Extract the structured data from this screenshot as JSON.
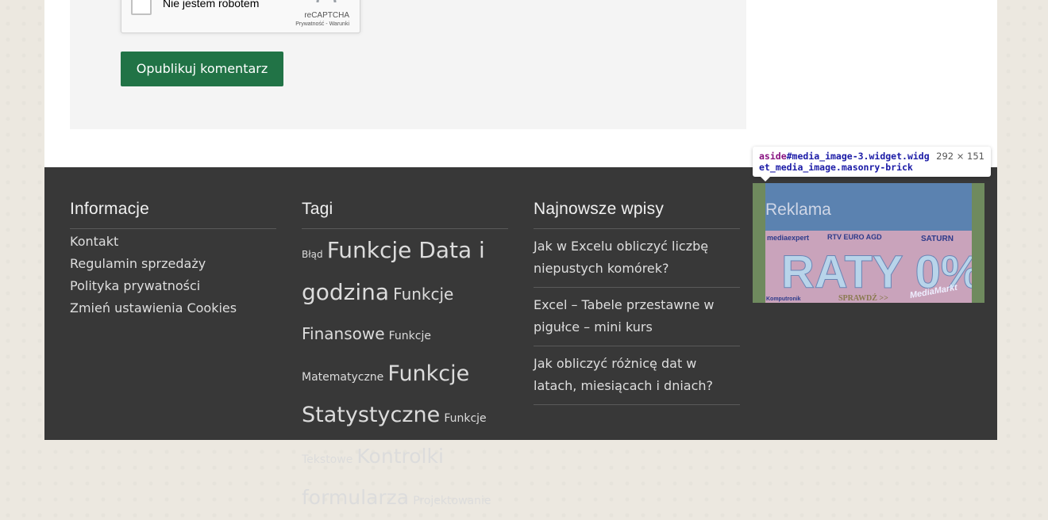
{
  "comment_form": {
    "recaptcha_label": "Nie jestem robotem",
    "recaptcha_brand": "reCAPTCHA",
    "recaptcha_terms": "Prywatność - Warunki",
    "submit_label": "Opublikuj komentarz"
  },
  "footer": {
    "info": {
      "title": "Informacje",
      "links": [
        "Kontakt",
        "Regulamin sprzedaży",
        "Polityka prywatności",
        "Zmień ustawienia Cookies"
      ]
    },
    "tags": {
      "title": "Tagi",
      "items": [
        {
          "label": "Błąd",
          "size": "xs"
        },
        {
          "label": "Funkcje Data i godzina",
          "size": "xl"
        },
        {
          "label": "Funkcje Finansowe",
          "size": "md"
        },
        {
          "label": "Funkcje Matematyczne",
          "size": "sm"
        },
        {
          "label": "Funkcje Statystyczne",
          "size": "xl"
        },
        {
          "label": "Funkcje Tekstowe",
          "size": "sm"
        },
        {
          "label": "Kontrolki formularza",
          "size": "lg"
        },
        {
          "label": "Projektowanie",
          "size": "sm"
        }
      ]
    },
    "recent": {
      "title": "Najnowsze wpisy",
      "posts": [
        "Jak w Excelu obliczyć liczbę niepustych komórek?",
        "Excel – Tabele przestawne w pigułce – mini kurs",
        "Jak obliczyć różnicę dat w latach, miesiącach i dniach?"
      ]
    },
    "ad": {
      "title": "Reklama",
      "banner": {
        "brands": [
          "mediaexpert",
          "RTV EURO AGD",
          "SATURN",
          "Komputronik",
          "MediaMarkt"
        ],
        "headline": "RATY 0%",
        "cta": "SPRAWDŹ >>"
      }
    }
  },
  "devtools_tooltip": {
    "tag": "aside",
    "selector": "#media_image-3.widget.widget_media_image.masonry-brick",
    "dimensions": "292 × 151"
  },
  "colors": {
    "accent_button": "#217346",
    "footer_bg": "#383838"
  }
}
